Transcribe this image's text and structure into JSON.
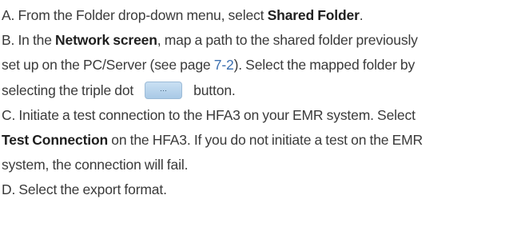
{
  "step_a": {
    "prefix": "A. From the Folder drop-down menu, select ",
    "bold": "Shared Folder",
    "suffix": "."
  },
  "step_b": {
    "prefix": "B. In the ",
    "bold": "Network screen",
    "line1_suffix": ", map a path to the shared folder previously",
    "line2_prefix": "set up on the PC/Server (see page ",
    "page_link": "7-2",
    "line2_suffix": "). Select the mapped folder by",
    "line3_prefix": "selecting the triple dot",
    "button_glyph": "...",
    "line3_suffix": "button."
  },
  "step_c": {
    "line1": "C. Initiate a test connection to the HFA3 on your EMR system. Select",
    "bold": "Test Connection",
    "line2_suffix": " on the HFA3. If you do not initiate a test on the EMR",
    "line3": "system, the connection will fail."
  },
  "step_d": {
    "text": "D. Select the export format."
  }
}
